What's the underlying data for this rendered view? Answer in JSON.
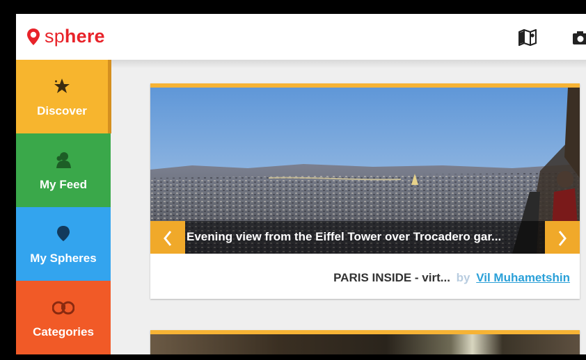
{
  "header": {
    "logo_light": "sp",
    "logo_bold": "here",
    "map_icon": "map-icon",
    "camera_icon": "camera-icon"
  },
  "sidebar": {
    "items": [
      {
        "label": "Discover",
        "icon": "star-icon",
        "color": "#f7b52e",
        "active": true
      },
      {
        "label": "My Feed",
        "icon": "user-icon",
        "color": "#3aa84a"
      },
      {
        "label": "My Spheres",
        "icon": "sphere-pin-icon",
        "color": "#33a4ee"
      },
      {
        "label": "Categories",
        "icon": "binoculars-icon",
        "color": "#f15a27"
      }
    ]
  },
  "cards": [
    {
      "caption": "Evening view from the Eiffel Tower over Trocadero gar...",
      "title": "PARIS INSIDE - virt...",
      "by": "by",
      "author": "Vil Muhametshin"
    }
  ],
  "colors": {
    "brand": "#e8232a",
    "accent": "#f6b335",
    "link": "#2aa0d8"
  }
}
